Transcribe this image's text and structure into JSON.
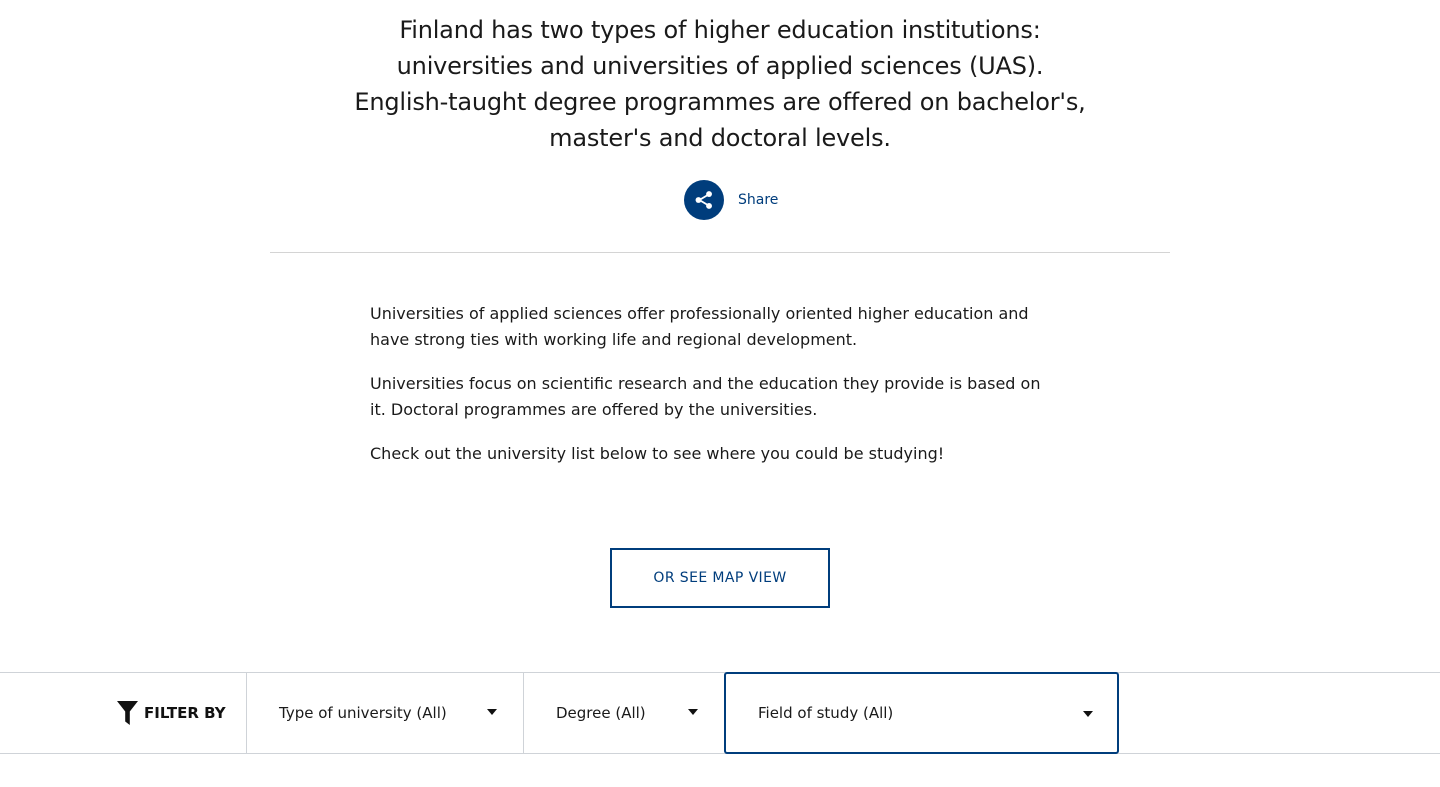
{
  "intro": {
    "line1": "Finland has two types of higher education institutions: universities and universities of applied sciences (UAS).",
    "line2": "English-taught degree programmes are offered on bachelor's, master's and doctoral levels."
  },
  "share": {
    "label": "Share",
    "icon": "share-icon"
  },
  "body": {
    "p1": "Universities of applied sciences offer professionally oriented higher education and have strong ties with working life and regional development.",
    "p2": "Universities focus on scientific research and the education they provide is based on it. Doctoral programmes are offered by the universities.",
    "p3": "Check out the university list below to see where you could be studying!"
  },
  "map_button": {
    "label": "OR SEE MAP VIEW"
  },
  "filters": {
    "label": "FILTER BY",
    "icon": "funnel-icon",
    "type_of_university": "Type of university (All)",
    "degree": "Degree (All)",
    "field_of_study": "Field of study (All)"
  },
  "colors": {
    "accent": "#003d7c",
    "border": "#cfd3d8",
    "text": "#1a1a1a"
  }
}
